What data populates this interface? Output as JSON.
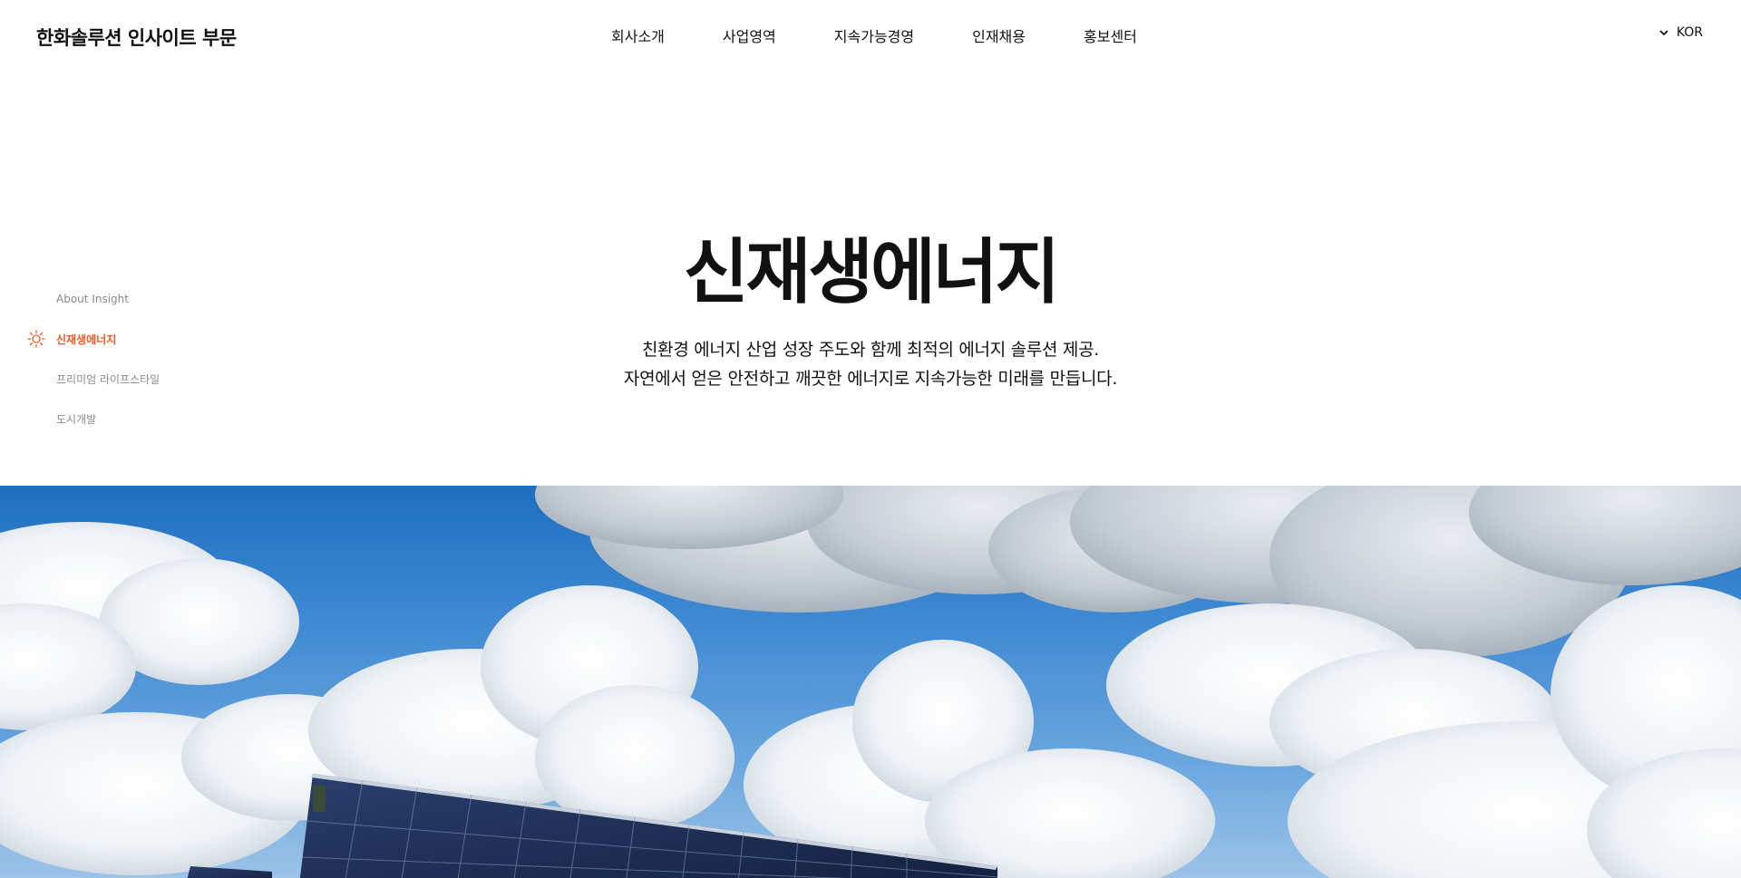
{
  "header": {
    "logo": "한화솔루션 인사이트 부문",
    "nav": [
      "회사소개",
      "사업영역",
      "지속가능경영",
      "인재채용",
      "홍보센터"
    ],
    "lang": "KOR"
  },
  "side_nav": {
    "items": [
      "About Insight",
      "신재생에너지",
      "프리미엄 라이프스타일",
      "도시개발"
    ],
    "active_index": 1
  },
  "hero": {
    "title": "신재생에너지",
    "desc_line1": "친환경 에너지 산업 성장 주도와 함께 최적의 에너지 솔루션 제공.",
    "desc_line2": "자연에서 얻은 안전하고 깨끗한 에너지로 지속가능한 미래를 만듭니다."
  },
  "colors": {
    "accent": "#f15a22",
    "sky": "#3f8ad3"
  },
  "icons": {
    "lang": "chevron-down-icon",
    "active_side": "sun-icon"
  }
}
